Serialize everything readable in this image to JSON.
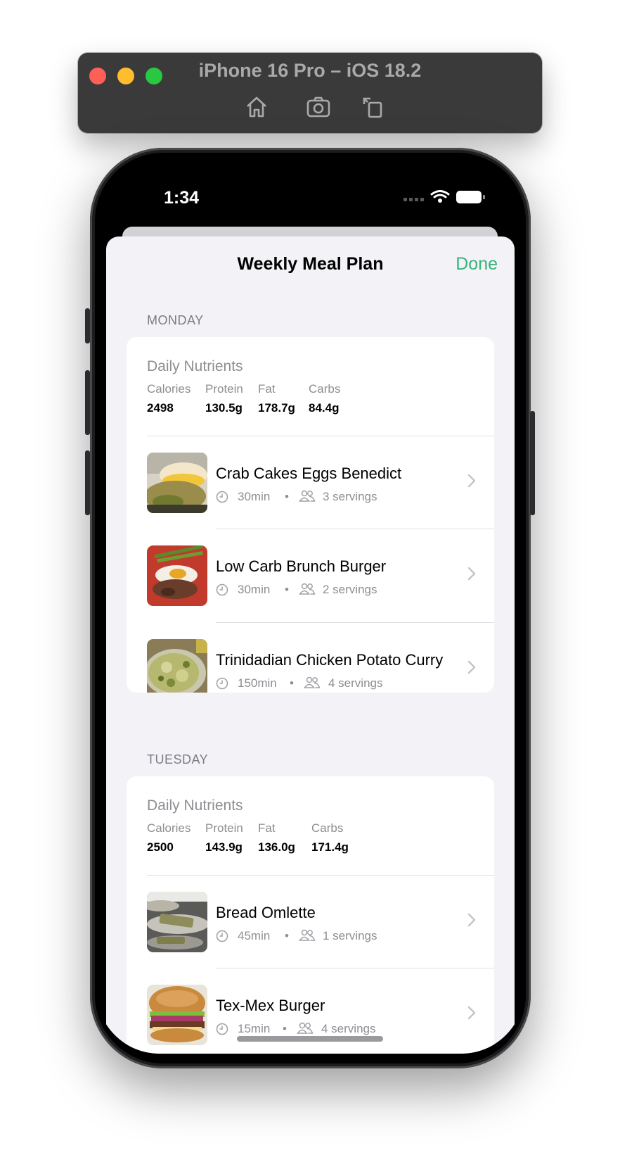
{
  "simulator": {
    "title": "iPhone 16 Pro – iOS 18.2",
    "tools": [
      "home-icon",
      "screenshot-icon",
      "rotate-icon"
    ]
  },
  "status_bar": {
    "time": "1:34"
  },
  "nav": {
    "title": "Weekly Meal Plan",
    "done_label": "Done"
  },
  "days": [
    {
      "name": "MONDAY",
      "nutrients_title": "Daily Nutrients",
      "nutrients": [
        {
          "label": "Calories",
          "value": "2498"
        },
        {
          "label": "Protein",
          "value": "130.5g"
        },
        {
          "label": "Fat",
          "value": "178.7g"
        },
        {
          "label": "Carbs",
          "value": "84.4g"
        }
      ],
      "meals": [
        {
          "name": "Crab Cakes Eggs Benedict",
          "time": "30min",
          "servings": "3 servings"
        },
        {
          "name": "Low Carb Brunch Burger",
          "time": "30min",
          "servings": "2 servings"
        },
        {
          "name": "Trinidadian Chicken Potato Curry",
          "time": "150min",
          "servings": "4 servings"
        }
      ]
    },
    {
      "name": "TUESDAY",
      "nutrients_title": "Daily Nutrients",
      "nutrients": [
        {
          "label": "Calories",
          "value": "2500"
        },
        {
          "label": "Protein",
          "value": "143.9g"
        },
        {
          "label": "Fat",
          "value": "136.0g"
        },
        {
          "label": "Carbs",
          "value": "171.4g"
        }
      ],
      "meals": [
        {
          "name": "Bread Omlette",
          "time": "45min",
          "servings": "1 servings"
        },
        {
          "name": "Tex-Mex Burger",
          "time": "15min",
          "servings": "4 servings"
        }
      ]
    }
  ],
  "meta_separator": "•",
  "colors": {
    "accent": "#3bb37a",
    "background": "#f2f2f7",
    "secondary_text": "#8e8e93"
  }
}
